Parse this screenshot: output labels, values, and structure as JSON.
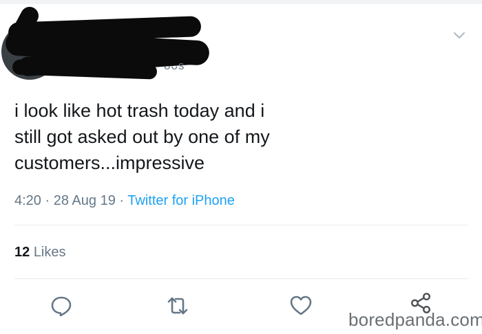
{
  "author": {
    "handle_fragment": "ᴗᴗs",
    "avatar_icon": "avatar"
  },
  "tweet": {
    "text_lines": [
      "i look like hot trash today and i",
      "still got asked out by one of my",
      "customers...impressive"
    ],
    "time": "4:20",
    "date": "28 Aug 19",
    "separator": "·",
    "source": "Twitter for iPhone"
  },
  "stats": {
    "likes_count": "12",
    "likes_label": "Likes"
  },
  "actions": {
    "reply_icon": "reply-icon",
    "retweet_icon": "retweet-icon",
    "like_icon": "heart-icon",
    "share_icon": "share-icon"
  },
  "watermark": "boredpanda.com",
  "colors": {
    "text": "#14171a",
    "secondary": "#657786",
    "accent": "#1da1f2",
    "divider": "#e6ecf0"
  }
}
